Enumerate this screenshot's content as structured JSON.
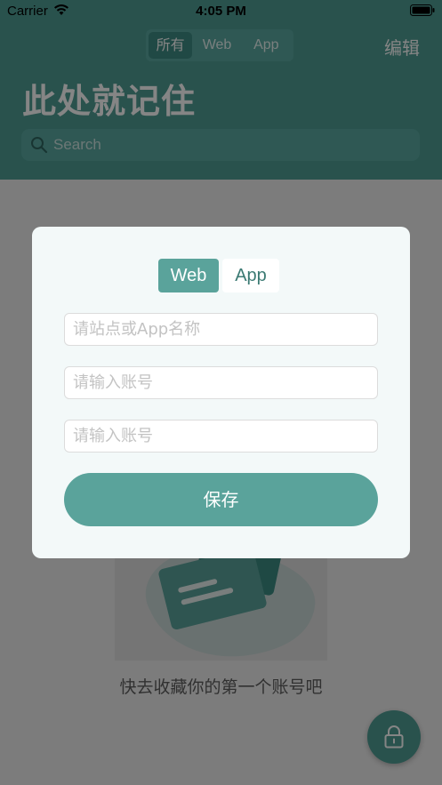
{
  "status_bar": {
    "carrier": "Carrier",
    "time": "4:05 PM"
  },
  "header": {
    "filter_tabs": [
      "所有",
      "Web",
      "App"
    ],
    "edit_label": "编辑",
    "title": "此处就记住",
    "search_placeholder": "Search"
  },
  "empty_state": {
    "message": "快去收藏你的第一个账号吧"
  },
  "modal": {
    "type_options": [
      "Web",
      "App"
    ],
    "selected_type": "Web",
    "name_placeholder": "请站点或App名称",
    "account_placeholder": "请输入账号",
    "password_placeholder": "请输入账号",
    "save_label": "保存"
  },
  "colors": {
    "accent": "#5aa39b",
    "header_bg": "#4f9e95",
    "fab_bg": "#4f9e95"
  }
}
